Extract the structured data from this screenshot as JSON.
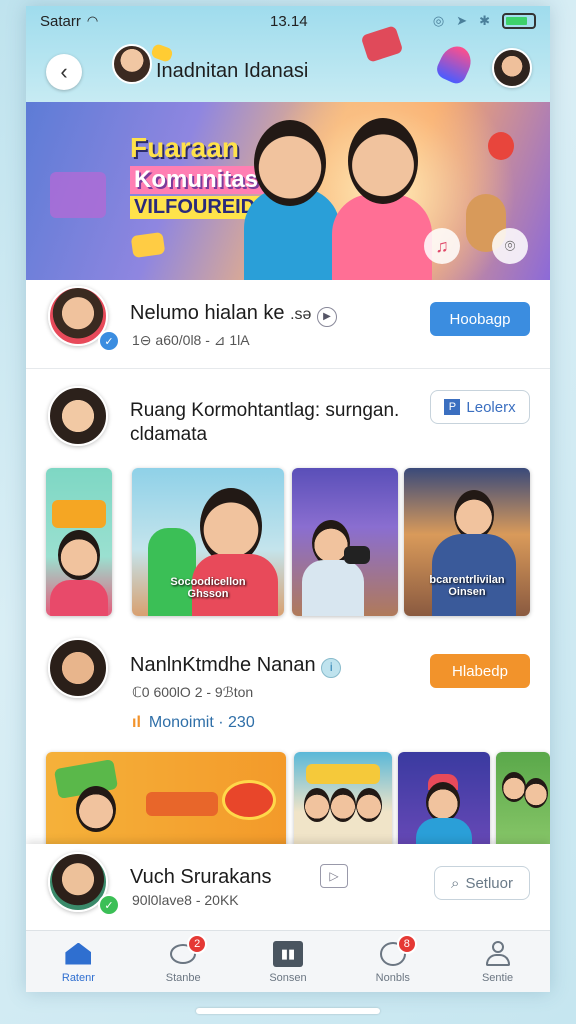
{
  "status_bar": {
    "carrier": "Satarr",
    "time": "13.14"
  },
  "header": {
    "title": "Inadnitan Idanasi"
  },
  "banner": {
    "line1": "Fuaraan",
    "line2": "Komunitas",
    "line3": "VILFOUREIDER"
  },
  "feed": [
    {
      "title": "Nelumo hialan ke",
      "title_suffix": ".sə",
      "meta": "1⊖ a60/0l8 - ⊿ 1lA",
      "button": "Hoobagp",
      "button_color": "#3b8de0"
    },
    {
      "title_line1": "Ruang Kormohtantlag: surngan.",
      "title_line2": "cldamata",
      "button": "Leolerx",
      "thumbnails": [
        {
          "caption": ""
        },
        {
          "caption_line1": "Socoodicellon",
          "caption_line2": "Ghsson"
        },
        {
          "caption": ""
        },
        {
          "caption_line1": "bcarentrlivilan",
          "caption_line2": "Oinsen"
        }
      ]
    },
    {
      "title": "NanlnKtmdhe Nanan",
      "meta": "ℂ0 600lO 2 - 9ℬton",
      "stat_label": "Monoimit · 230",
      "button": "Hlabedp",
      "button_color": "#f2932b"
    }
  ],
  "bottom_card": {
    "title": "Vuch Srurakans",
    "meta": "90l0lave8 - 20KK",
    "button": "Setluor"
  },
  "tabs": [
    {
      "label": "Ratenr",
      "icon": "home-icon",
      "active": true
    },
    {
      "label": "Stanbe",
      "icon": "chat-icon",
      "badge": "2"
    },
    {
      "label": "Sonsen",
      "icon": "video-icon"
    },
    {
      "label": "Nonbls",
      "icon": "bell-icon",
      "badge": "8"
    },
    {
      "label": "Sentie",
      "icon": "profile-icon"
    }
  ]
}
